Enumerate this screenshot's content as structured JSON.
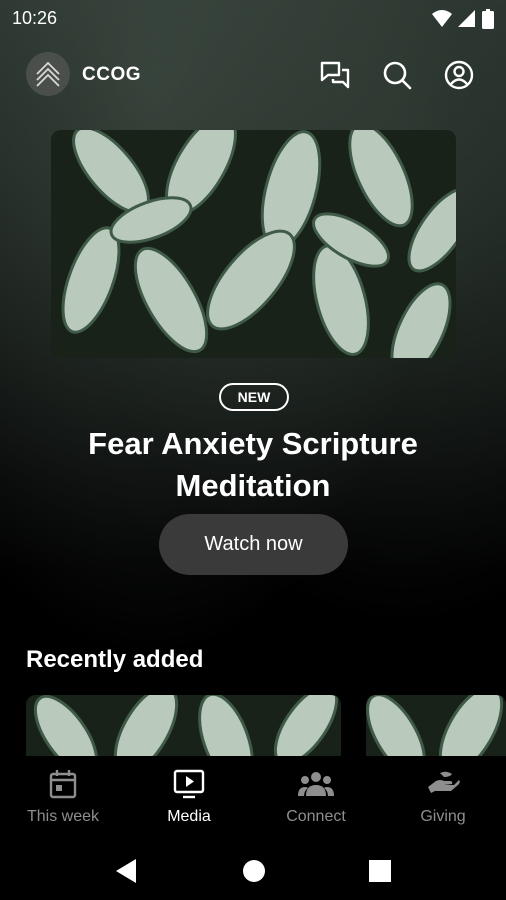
{
  "status_bar": {
    "time": "10:26",
    "icons": [
      "wifi-icon",
      "cellular-icon",
      "battery-icon"
    ]
  },
  "header": {
    "brand": "CCOG",
    "actions": [
      "chat-icon",
      "search-icon",
      "account-icon"
    ]
  },
  "hero": {
    "badge": "NEW",
    "title": "Fear Anxiety Scripture Meditation",
    "cta": "Watch now"
  },
  "recently_added": {
    "heading": "Recently added"
  },
  "bottom_nav": {
    "items": [
      {
        "label": "This week",
        "icon": "calendar-icon",
        "active": false
      },
      {
        "label": "Media",
        "icon": "tv-play-icon",
        "active": true
      },
      {
        "label": "Connect",
        "icon": "group-icon",
        "active": false
      },
      {
        "label": "Giving",
        "icon": "hand-icon",
        "active": false
      }
    ]
  },
  "colors": {
    "background": "#000000",
    "button": "#3a3a3a",
    "inactive_nav": "#8e8e8e",
    "foliage": "#1e2a22"
  }
}
